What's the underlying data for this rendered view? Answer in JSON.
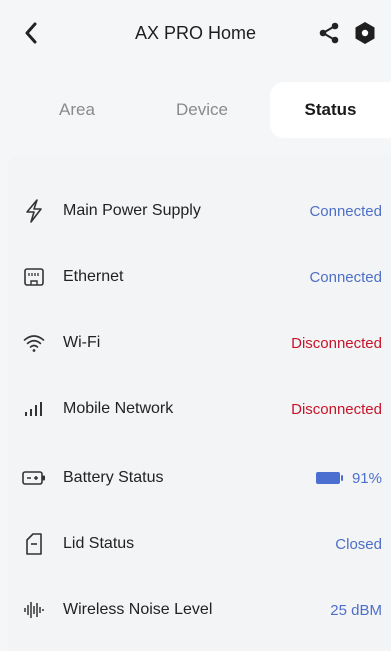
{
  "header": {
    "title": "AX PRO Home",
    "back_icon": "chevron-left-icon",
    "share_icon": "share-icon",
    "settings_icon": "hexagon-settings-icon"
  },
  "tabs": [
    {
      "label": "Area",
      "selected": false
    },
    {
      "label": "Device",
      "selected": false
    },
    {
      "label": "Status",
      "selected": true
    }
  ],
  "status_items": [
    {
      "label": "Main Power Supply",
      "value": "Connected",
      "icon": "lightning-icon",
      "state": "ok"
    },
    {
      "label": "Ethernet",
      "value": "Connected",
      "icon": "ethernet-port-icon",
      "state": "ok"
    },
    {
      "label": "Wi-Fi",
      "value": "Disconnected",
      "icon": "wifi-icon",
      "state": "bad"
    },
    {
      "label": "Mobile Network",
      "value": "Disconnected",
      "icon": "signal-bars-icon",
      "state": "bad"
    },
    {
      "label": "Battery Status",
      "value": "91%",
      "icon": "battery-icon",
      "state": "ok",
      "level": 0.91
    },
    {
      "label": "Lid Status",
      "value": "Closed",
      "icon": "lid-icon",
      "state": "ok"
    },
    {
      "label": "Wireless Noise Level",
      "value": "25 dBM",
      "icon": "noise-wave-icon",
      "state": "ok"
    }
  ],
  "colors": {
    "ok": "#4d6fc7",
    "bad": "#c8142a",
    "background": "#f5f6f8"
  }
}
